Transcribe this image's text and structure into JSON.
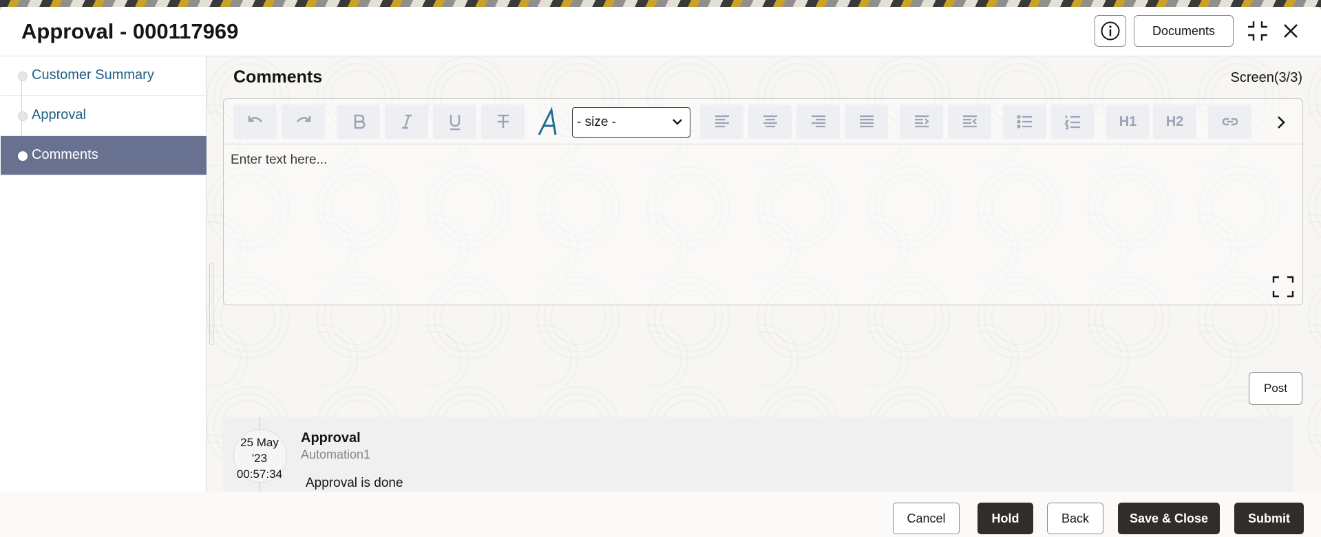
{
  "header": {
    "title": "Approval - 000117969",
    "documents_label": "Documents"
  },
  "sidebar": {
    "items": [
      {
        "label": "Customer Summary",
        "active": false
      },
      {
        "label": "Approval",
        "active": false
      },
      {
        "label": "Comments",
        "active": true
      }
    ]
  },
  "main": {
    "section_title": "Comments",
    "screen_count": "Screen(3/3)",
    "editor": {
      "size_select_value": "- size -",
      "placeholder": "Enter text here...",
      "h1_label": "H1",
      "h2_label": "H2"
    },
    "post_label": "Post",
    "comments": [
      {
        "date": "25 May",
        "year": "'23",
        "time": "00:57:34",
        "title": "Approval",
        "user": "Automation1",
        "body": "Approval is done"
      }
    ]
  },
  "footer": {
    "cancel": "Cancel",
    "hold": "Hold",
    "back": "Back",
    "save_close": "Save & Close",
    "submit": "Submit"
  },
  "colors": {
    "accent_dark": "#312d2a",
    "sidebar_active": "#68718f",
    "link": "#1f5f85"
  }
}
